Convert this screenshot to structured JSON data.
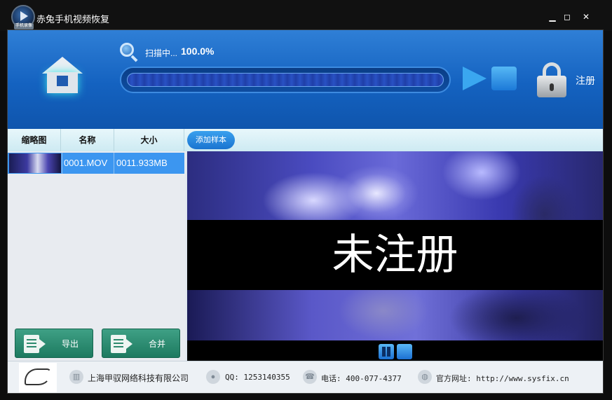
{
  "window": {
    "title": "赤兔手机视频恢复",
    "logo_tag": "手机录像",
    "minimize": "▁",
    "maximize": "◻",
    "close": "✕"
  },
  "header": {
    "scan_label": "扫描中...",
    "scan_percent": "100.0%",
    "progress": 1.0,
    "register_label": "注册"
  },
  "list": {
    "columns": [
      "缩略图",
      "名称",
      "大小"
    ],
    "rows": [
      {
        "name": "0001.MOV",
        "size": "0011.933MB"
      }
    ],
    "add_sample_label": "添加样本",
    "export_label": "导出",
    "merge_label": "合并"
  },
  "video": {
    "watermark": "未注册"
  },
  "footer": {
    "company": "上海甲驭网络科技有限公司",
    "qq": "QQ: 1253140355",
    "phone": "电话: 400-077-4377",
    "website": "官方网址: http://www.sysfix.cn"
  },
  "icons": {
    "home": "home-icon",
    "search": "magnifier-icon",
    "play": "play-icon",
    "stop": "stop-icon",
    "lock": "lock-icon",
    "company": "building-icon",
    "qq": "qq-icon",
    "phone": "phone-icon",
    "web": "globe-icon"
  },
  "colors": {
    "header_blue": "#1462c0",
    "row_selected": "#3c96f0",
    "button_green": "#2d8a6e",
    "watermark_band": "#000000"
  }
}
